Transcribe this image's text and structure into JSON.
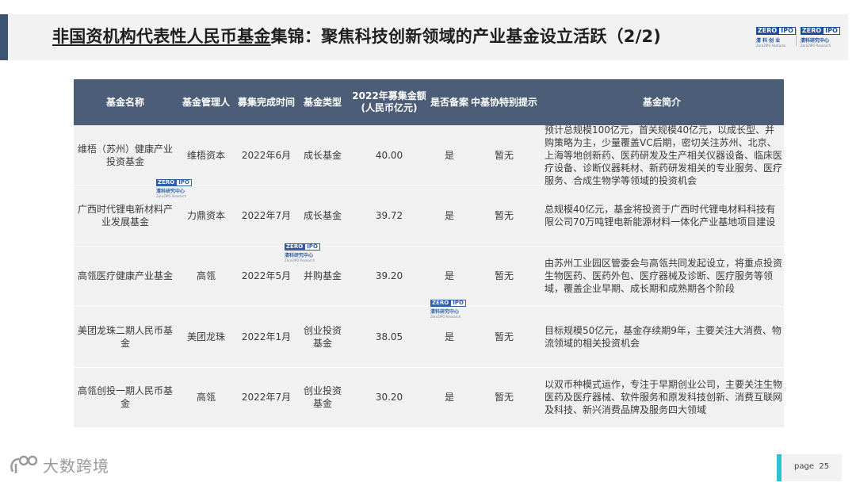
{
  "header": {
    "title_underlined": "非国资机构代表性人民币基金",
    "title_rest": "集锦：聚焦科技创新领域的产业基金设立活跃（2/2)"
  },
  "logos": {
    "zero": "ZERO",
    "ipo": "IPO",
    "logo1_cn": "清 科 创 业",
    "logo1_en": "Zero2IPO Ventures",
    "logo2_cn": "清科研究中心",
    "logo2_en": "Zero2IPO Research"
  },
  "watermark": {
    "zero": "ZERO",
    "ipo": "IPO",
    "cn": "清科研究中心",
    "en": "Zero2IPO Research"
  },
  "table": {
    "headers": [
      "基金名称",
      "基金管理人",
      "募集完成时间",
      "基金类型",
      "2022年募集金额(人民币亿元)",
      "是否备案",
      "中基协特别提示",
      "基金简介"
    ],
    "rows": [
      {
        "name": "维梧（苏州）健康产业投资基金",
        "manager": "维梧资本",
        "date": "2022年6月",
        "type": "成长基金",
        "amount": "40.00",
        "filed": "是",
        "notice": "暂无",
        "desc": "预计总规模100亿元，首关规模40亿元，以成长型、并购策略为主，少量覆盖VC后期，密切关注苏州、北京、上海等地创新药、医药研发及生产相关仪器设备、临床医疗设备、诊断仪器耗材、新药研发相关的专业服务、医疗服务、合成生物学等领域的投资机会"
      },
      {
        "name": "广西时代锂电新材料产业发展基金",
        "manager": "力鼎资本",
        "date": "2022年7月",
        "type": "成长基金",
        "amount": "39.72",
        "filed": "是",
        "notice": "暂无",
        "desc": "总规模40亿元，基金将投资于广西时代锂电材料科技有限公司70万吨锂电新能源材料一体化产业基地项目建设"
      },
      {
        "name": "高瓴医疗健康产业基金",
        "manager": "高瓴",
        "date": "2022年5月",
        "type": "并购基金",
        "amount": "39.20",
        "filed": "是",
        "notice": "暂无",
        "desc": "由苏州工业园区管委会与高瓴共同发起设立，将重点投资生物医药、医药外包、医疗器械及诊断、医疗服务等领域，覆盖企业早期、成长期和成熟期各个阶段"
      },
      {
        "name": "美团龙珠二期人民币基金",
        "manager": "美团龙珠",
        "date": "2022年1月",
        "type": "创业投资基金",
        "amount": "38.05",
        "filed": "是",
        "notice": "暂无",
        "desc": "目标规模50亿元，基金存续期9年，主要关注大消费、物流领域的相关投资机会"
      },
      {
        "name": "高瓴创投一期人民币基金",
        "manager": "高瓴",
        "date": "2022年7月",
        "type": "创业投资基金",
        "amount": "30.20",
        "filed": "是",
        "notice": "暂无",
        "desc": "以双币种模式运作，专注于早期创业公司，主要关注生物医药及医疗器械、软件服务和原发科技创新、消费互联网及科技、新兴消费品牌及服务四大领域"
      }
    ]
  },
  "footer": {
    "brand": "大数跨境",
    "page": "page  25"
  }
}
